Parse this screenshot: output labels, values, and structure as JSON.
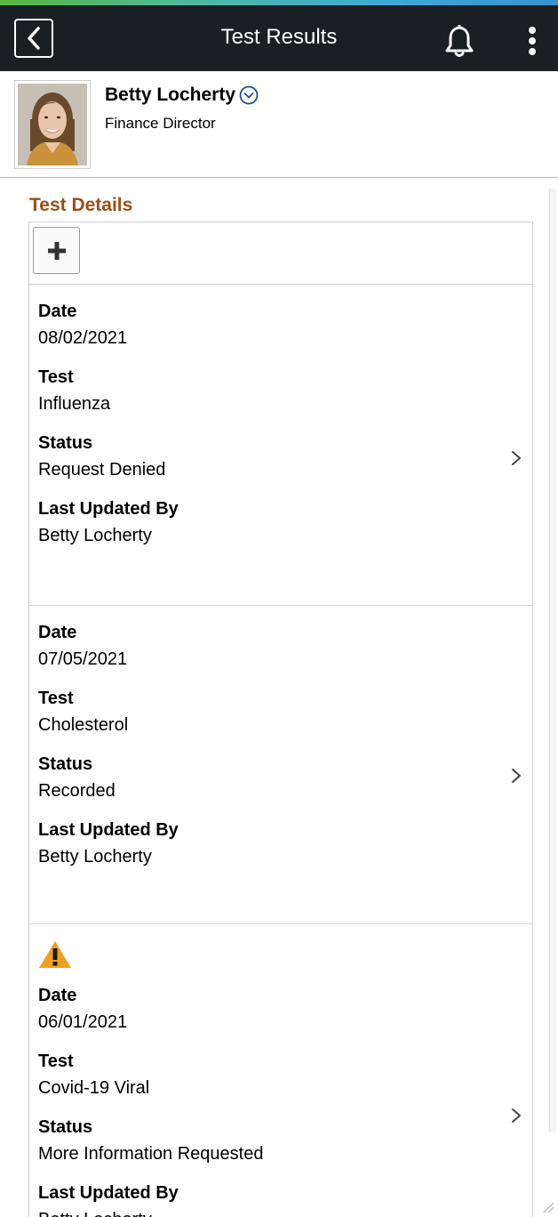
{
  "header": {
    "title": "Test Results"
  },
  "profile": {
    "name": "Betty Locherty",
    "job_title": "Finance Director"
  },
  "section": {
    "title": "Test Details"
  },
  "field_labels": {
    "date": "Date",
    "test": "Test",
    "status": "Status",
    "updated_by": "Last Updated By"
  },
  "records": [
    {
      "date": "08/02/2021",
      "test": "Influenza",
      "status": "Request Denied",
      "updated_by": "Betty Locherty",
      "warning": false
    },
    {
      "date": "07/05/2021",
      "test": "Cholesterol",
      "status": "Recorded",
      "updated_by": "Betty Locherty",
      "warning": false
    },
    {
      "date": "06/01/2021",
      "test": "Covid-19 Viral",
      "status": "More Information Requested",
      "updated_by": "Betty Locherty",
      "warning": true
    }
  ],
  "colors": {
    "topbar": "#1a1f24",
    "section_title": "#9a4f1a",
    "warning": "#f0a020"
  }
}
